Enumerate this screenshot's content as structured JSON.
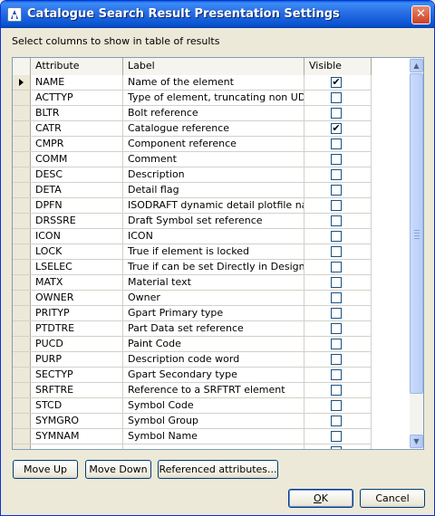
{
  "window": {
    "title": "Catalogue Search Result Presentation Settings",
    "close_glyph": "✕",
    "icon": "app-icon"
  },
  "instruction": "Select columns to show in table of results",
  "table": {
    "headers": {
      "attribute": "Attribute",
      "label": "Label",
      "visible": "Visible"
    },
    "current_row_index": 0,
    "rows": [
      {
        "attribute": "NAME",
        "label": "Name of the element",
        "visible": true
      },
      {
        "attribute": "ACTTYP",
        "label": "Type of element, truncating non UDET",
        "visible": false
      },
      {
        "attribute": "BLTR",
        "label": "Bolt reference",
        "visible": false
      },
      {
        "attribute": "CATR",
        "label": "Catalogue reference",
        "visible": true
      },
      {
        "attribute": "CMPR",
        "label": "Component reference",
        "visible": false
      },
      {
        "attribute": "COMM",
        "label": "Comment",
        "visible": false
      },
      {
        "attribute": "DESC",
        "label": "Description",
        "visible": false
      },
      {
        "attribute": "DETA",
        "label": "Detail flag",
        "visible": false
      },
      {
        "attribute": "DPFN",
        "label": "ISODRAFT dynamic detail plotfile nam",
        "visible": false
      },
      {
        "attribute": "DRSSRE",
        "label": "Draft Symbol set reference",
        "visible": false
      },
      {
        "attribute": "ICON",
        "label": "ICON",
        "visible": false
      },
      {
        "attribute": "LOCK",
        "label": "True if element is locked",
        "visible": false
      },
      {
        "attribute": "LSELEC",
        "label": "True if can be set Directly in Design",
        "visible": false
      },
      {
        "attribute": "MATX",
        "label": "Material text",
        "visible": false
      },
      {
        "attribute": "OWNER",
        "label": "Owner",
        "visible": false
      },
      {
        "attribute": "PRITYP",
        "label": "Gpart Primary type",
        "visible": false
      },
      {
        "attribute": "PTDTRE",
        "label": "Part Data set reference",
        "visible": false
      },
      {
        "attribute": "PUCD",
        "label": "Paint Code",
        "visible": false
      },
      {
        "attribute": "PURP",
        "label": "Description code word",
        "visible": false
      },
      {
        "attribute": "SECTYP",
        "label": "Gpart Secondary type",
        "visible": false
      },
      {
        "attribute": "SRFTRE",
        "label": "Reference to a SRFTRT element",
        "visible": false
      },
      {
        "attribute": "STCD",
        "label": "Symbol Code",
        "visible": false
      },
      {
        "attribute": "SYMGRO",
        "label": "Symbol Group",
        "visible": false
      },
      {
        "attribute": "SYMNAM",
        "label": "Symbol Name",
        "visible": false
      },
      {
        "attribute": "",
        "label": "",
        "visible": false
      }
    ]
  },
  "buttons": {
    "move_up": "Move Up",
    "move_down": "Move Down",
    "referenced_attributes": "Referenced attributes...",
    "ok_underlined": "O",
    "ok_rest": "K",
    "cancel": "Cancel"
  },
  "checkmark": "✔",
  "colors": {
    "title_bar": "#0a5fd8",
    "dialog_bg": "#ece9d8",
    "button_border": "#003c74"
  }
}
